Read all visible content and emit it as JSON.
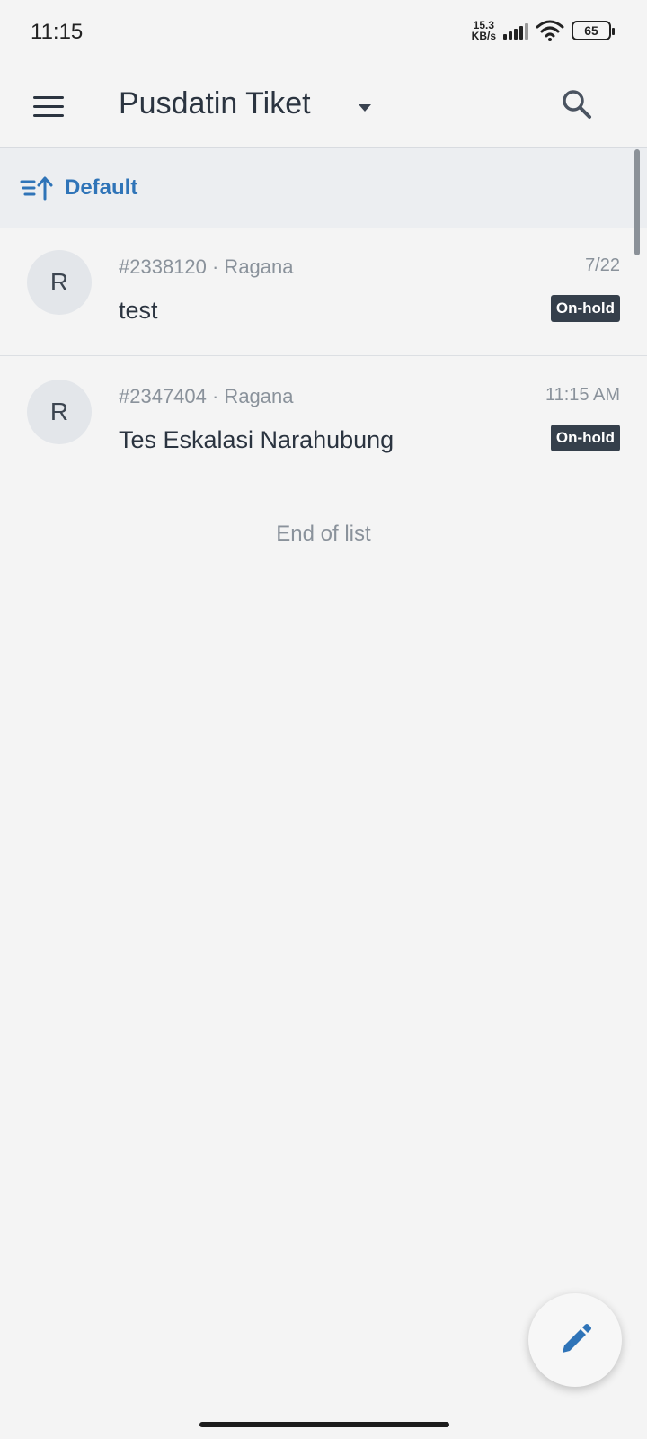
{
  "status_bar": {
    "time": "11:15",
    "net_speed_value": "15.3",
    "net_speed_unit": "KB/s",
    "battery": "65"
  },
  "app_bar": {
    "title": "Pusdatin Tiket",
    "icons": [
      "menu-icon",
      "caret-down-icon",
      "search-icon"
    ]
  },
  "sort": {
    "label": "Default",
    "icon": "sort-ascending-icon",
    "accent": "#2f74b8"
  },
  "tickets": [
    {
      "avatar": "R",
      "meta": "#2338120 · Ragana",
      "time": "7/22",
      "subject": "test",
      "status": "On-hold"
    },
    {
      "avatar": "R",
      "meta": "#2347404 · Ragana",
      "time": "11:15 AM",
      "subject": "Tes Eskalasi Narahubung",
      "status": "On-hold"
    }
  ],
  "end_of_list": "End of list",
  "fab": {
    "icon": "pencil-icon",
    "color": "#2f74b8"
  }
}
